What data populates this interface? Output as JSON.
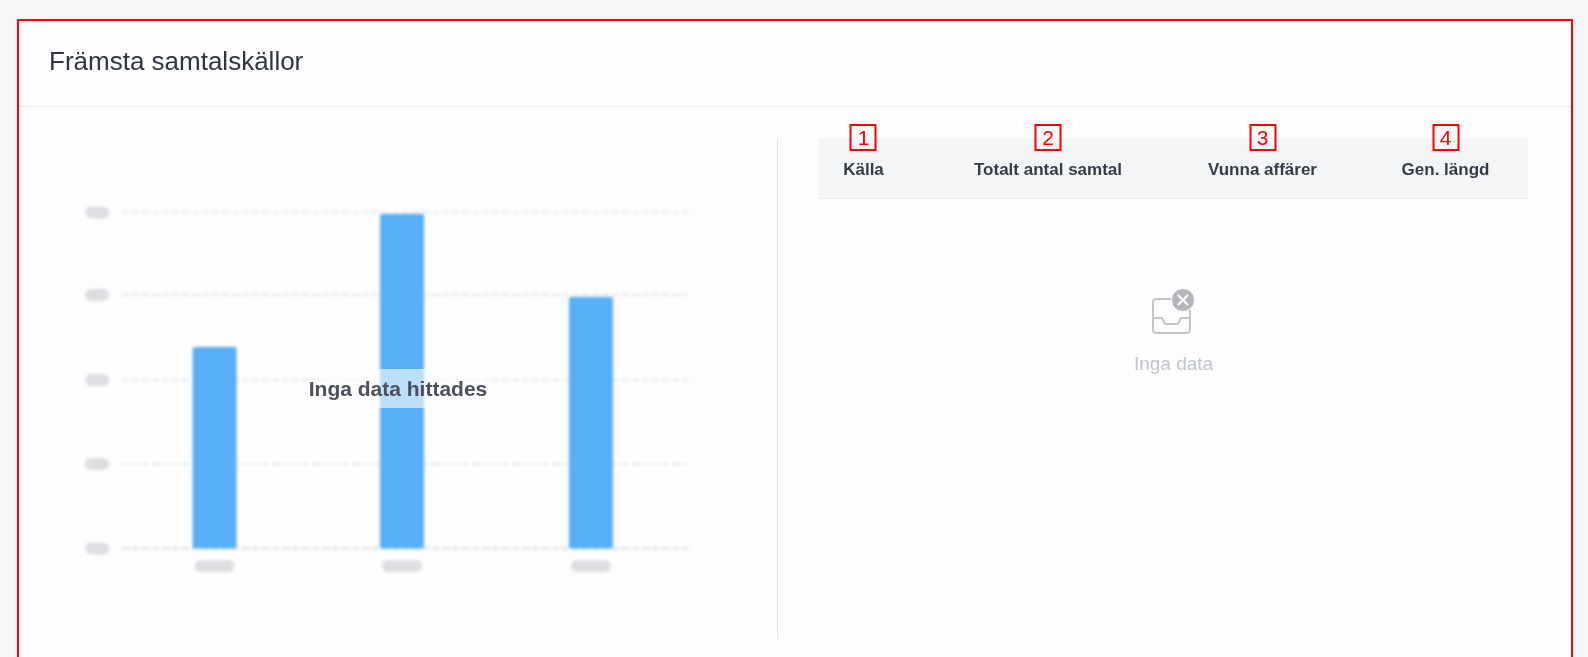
{
  "card": {
    "title": "Främsta samtalskällor",
    "highlighted": true
  },
  "chart": {
    "message": "Inga data hittades"
  },
  "table": {
    "columns": [
      {
        "label": "Källa",
        "marker": "1"
      },
      {
        "label": "Totalt antal samtal",
        "marker": "2"
      },
      {
        "label": "Vunna affärer",
        "marker": "3"
      },
      {
        "label": "Gen. längd",
        "marker": "4"
      }
    ],
    "empty_text": "Inga data"
  }
}
